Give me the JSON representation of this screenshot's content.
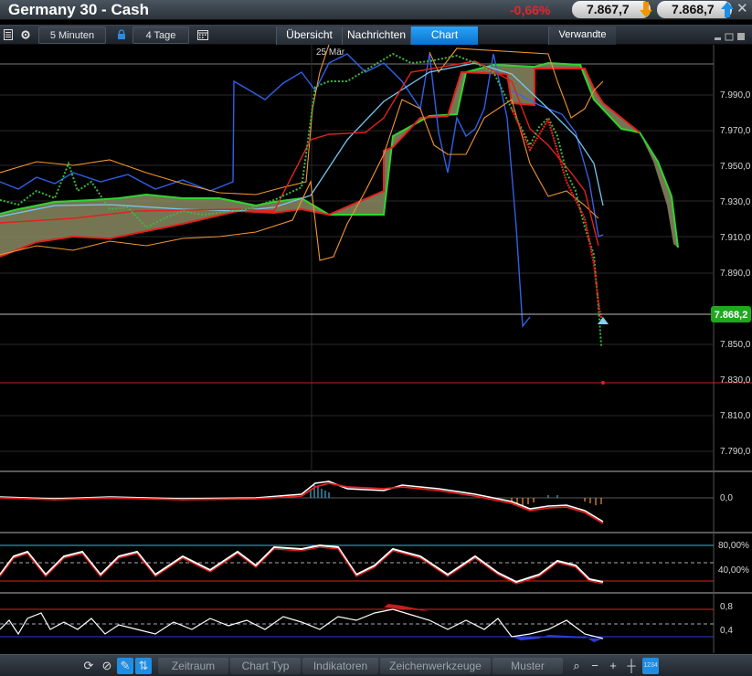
{
  "window": {
    "title": "Germany 30 - Cash",
    "change": "-0,66%",
    "bid": "7.867,7",
    "ask": "7.868,7",
    "bid_arrow": "arrow-down-orange-icon",
    "ask_arrow": "arrow-up-blue-icon"
  },
  "toolbar": {
    "interval": "5 Minuten",
    "range": "4 Tage",
    "tabs": [
      "Übersicht",
      "Nachrichten",
      "Chart",
      "Verwandte"
    ],
    "active_tab": "Chart"
  },
  "chart": {
    "date_marker": "25 Mär",
    "price_ticks": [
      "7.990,0",
      "7.970,0",
      "7.950,0",
      "7.930,0",
      "7.910,0",
      "7.890,0",
      "7.850,0",
      "7.830,0",
      "7.810,0",
      "7.790,0"
    ],
    "current_price": "7.868,2",
    "macd_tick": "0,0",
    "stoch_ticks": [
      "80,00%",
      "40,00%"
    ],
    "osc_ticks": [
      "0,8",
      "0,4"
    ],
    "colors": {
      "cloud_up": "#2ed62e",
      "cloud_down": "#e0221e",
      "price_tag": "#1fa81f",
      "active_tab": "#1a8de4"
    }
  },
  "bottombar": {
    "items": [
      "Zeitraum",
      "Chart Typ",
      "Indikatoren",
      "Zeichenwerkzeuge",
      "Muster"
    ],
    "icon_label": "1234"
  }
}
